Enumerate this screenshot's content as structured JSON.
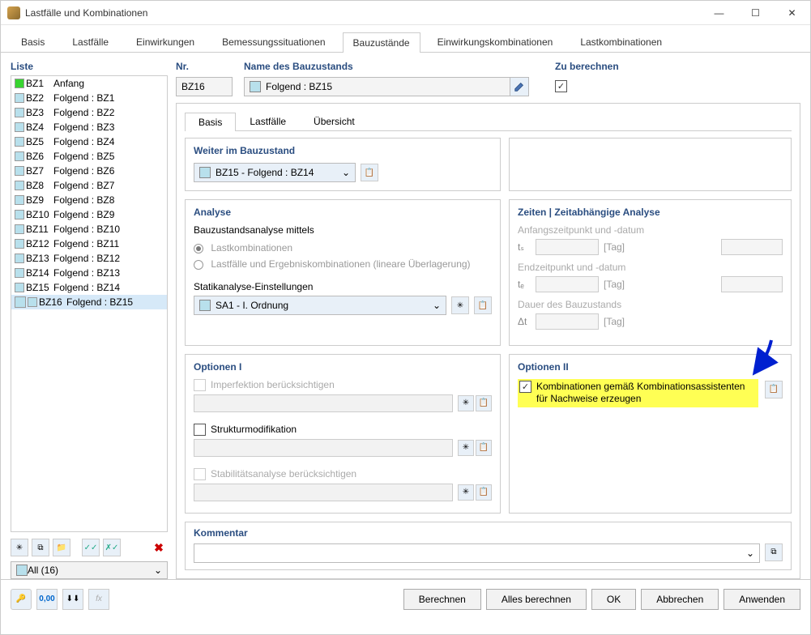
{
  "window": {
    "title": "Lastfälle und Kombinationen"
  },
  "main_tabs": [
    "Basis",
    "Lastfälle",
    "Einwirkungen",
    "Bemessungssituationen",
    "Bauzustände",
    "Einwirkungskombinationen",
    "Lastkombinationen"
  ],
  "main_tab_active": 4,
  "list": {
    "label": "Liste",
    "items": [
      {
        "id": "BZ1",
        "name": "Anfang",
        "color": "#38d430"
      },
      {
        "id": "BZ2",
        "name": "Folgend : BZ1",
        "color": "#b8e0ec"
      },
      {
        "id": "BZ3",
        "name": "Folgend : BZ2",
        "color": "#b8e0ec"
      },
      {
        "id": "BZ4",
        "name": "Folgend : BZ3",
        "color": "#b8e0ec"
      },
      {
        "id": "BZ5",
        "name": "Folgend : BZ4",
        "color": "#b8e0ec"
      },
      {
        "id": "BZ6",
        "name": "Folgend : BZ5",
        "color": "#b8e0ec"
      },
      {
        "id": "BZ7",
        "name": "Folgend : BZ6",
        "color": "#b8e0ec"
      },
      {
        "id": "BZ8",
        "name": "Folgend : BZ7",
        "color": "#b8e0ec"
      },
      {
        "id": "BZ9",
        "name": "Folgend : BZ8",
        "color": "#b8e0ec"
      },
      {
        "id": "BZ10",
        "name": "Folgend : BZ9",
        "color": "#b8e0ec"
      },
      {
        "id": "BZ11",
        "name": "Folgend : BZ10",
        "color": "#b8e0ec"
      },
      {
        "id": "BZ12",
        "name": "Folgend : BZ11",
        "color": "#b8e0ec"
      },
      {
        "id": "BZ13",
        "name": "Folgend : BZ12",
        "color": "#b8e0ec"
      },
      {
        "id": "BZ14",
        "name": "Folgend : BZ13",
        "color": "#b8e0ec"
      },
      {
        "id": "BZ15",
        "name": "Folgend : BZ14",
        "color": "#b8e0ec"
      },
      {
        "id": "BZ16",
        "name": "Folgend : BZ15",
        "color": "#b8e0ec"
      }
    ],
    "selected_index": 15,
    "filter": "All (16)"
  },
  "top": {
    "nr_label": "Nr.",
    "nr_value": "BZ16",
    "name_label": "Name des Bauzustands",
    "name_value": "Folgend : BZ15",
    "calc_label": "Zu berechnen",
    "calc_checked": true
  },
  "sub_tabs": [
    "Basis",
    "Lastfälle",
    "Übersicht"
  ],
  "sub_tab_active": 0,
  "weiter": {
    "title": "Weiter im Bauzustand",
    "value": "BZ15 - Folgend : BZ14"
  },
  "analyse": {
    "title": "Analyse",
    "mittels": "Bauzustandsanalyse mittels",
    "r1": "Lastkombinationen",
    "r2": "Lastfälle und Ergebniskombinationen (lineare Überlagerung)",
    "statik_label": "Statikanalyse-Einstellungen",
    "statik_value": "SA1 - I. Ordnung"
  },
  "zeiten": {
    "title": "Zeiten | Zeitabhängige Analyse",
    "anfang": "Anfangszeitpunkt und -datum",
    "end": "Endzeitpunkt und -datum",
    "dauer": "Dauer des Bauzustands",
    "ts": "tₛ",
    "te": "tₑ",
    "dt": "Δt",
    "unit": "[Tag]"
  },
  "opt1": {
    "title": "Optionen I",
    "imp": "Imperfektion berücksichtigen",
    "struct": "Strukturmodifikation",
    "stab": "Stabilitätsanalyse berücksichtigen"
  },
  "opt2": {
    "title": "Optionen II",
    "combo": "Kombinationen gemäß Kombinationsassistenten für Nachweise erzeugen"
  },
  "kommentar": {
    "title": "Kommentar"
  },
  "footer": {
    "berechnen": "Berechnen",
    "alles": "Alles berechnen",
    "ok": "OK",
    "abbrechen": "Abbrechen",
    "anwenden": "Anwenden"
  }
}
